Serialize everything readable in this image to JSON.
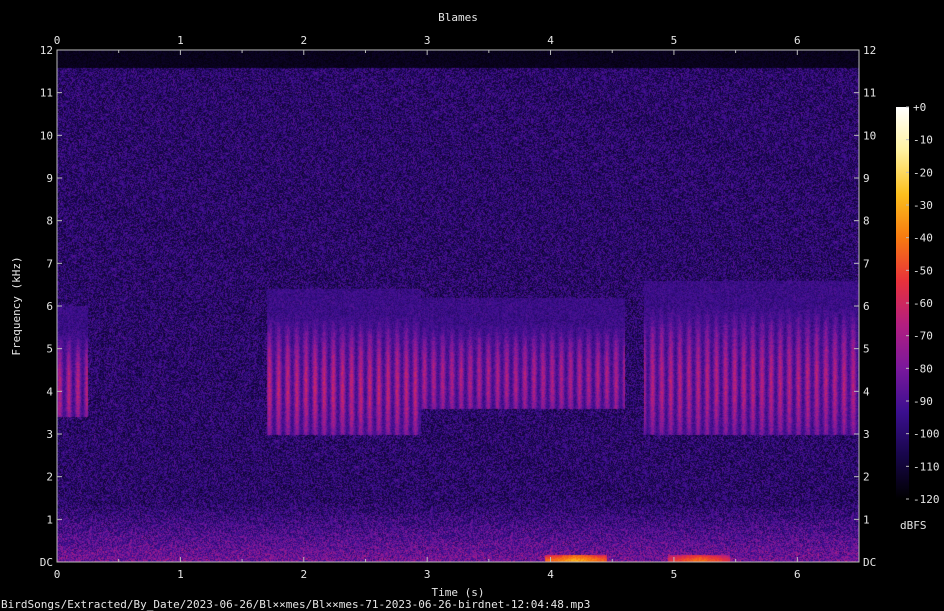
{
  "chart_data": {
    "type": "heatmap",
    "title": "Blames",
    "xlabel": "Time (s)",
    "ylabel": "Frequency (kHz)",
    "xlim": [
      0,
      6.5
    ],
    "ylim": [
      0,
      12
    ],
    "x_ticks": [
      "0",
      "1",
      "2",
      "3",
      "4",
      "5",
      "6"
    ],
    "y_ticks": [
      "DC",
      "1",
      "2",
      "3",
      "4",
      "5",
      "6",
      "7",
      "8",
      "9",
      "10",
      "11",
      "12"
    ],
    "colorbar": {
      "label": "dBFS",
      "range": [
        -120,
        0
      ],
      "ticks": [
        "+0",
        "-10",
        "-20",
        "-30",
        "-40",
        "-50",
        "-60",
        "-70",
        "-80",
        "-90",
        "-100",
        "-110",
        "-120"
      ],
      "colors": [
        "#000000",
        "#17064a",
        "#3b0f8f",
        "#7a189c",
        "#b31e80",
        "#e8313b",
        "#f77a10",
        "#fcc01e",
        "#fff2a0",
        "#ffffff"
      ]
    },
    "noise_cutoff_khz": 11.6,
    "call_events": [
      {
        "start_s": 0.0,
        "end_s": 0.25,
        "low_khz": 3.4,
        "high_khz": 6.0,
        "level_db": -70
      },
      {
        "start_s": 1.7,
        "end_s": 2.95,
        "low_khz": 3.0,
        "high_khz": 6.4,
        "level_db": -68
      },
      {
        "start_s": 2.95,
        "end_s": 4.6,
        "low_khz": 3.6,
        "high_khz": 6.2,
        "level_db": -72
      },
      {
        "start_s": 4.75,
        "end_s": 6.5,
        "low_khz": 3.0,
        "high_khz": 6.6,
        "level_db": -70
      }
    ],
    "low_freq_band": {
      "low_khz": 0.0,
      "high_khz": 0.6,
      "level_db": -65
    },
    "hot_spots": [
      {
        "time_s": 4.2,
        "freq_khz": 0.05,
        "level_db": -30
      },
      {
        "time_s": 5.2,
        "freq_khz": 0.05,
        "level_db": -40
      }
    ]
  },
  "footer": {
    "file_path": "BirdSongs/Extracted/By_Date/2023-06-26/Bl××mes/Bl××mes-71-2023-06-26-birdnet-12:04:48.mp3"
  }
}
